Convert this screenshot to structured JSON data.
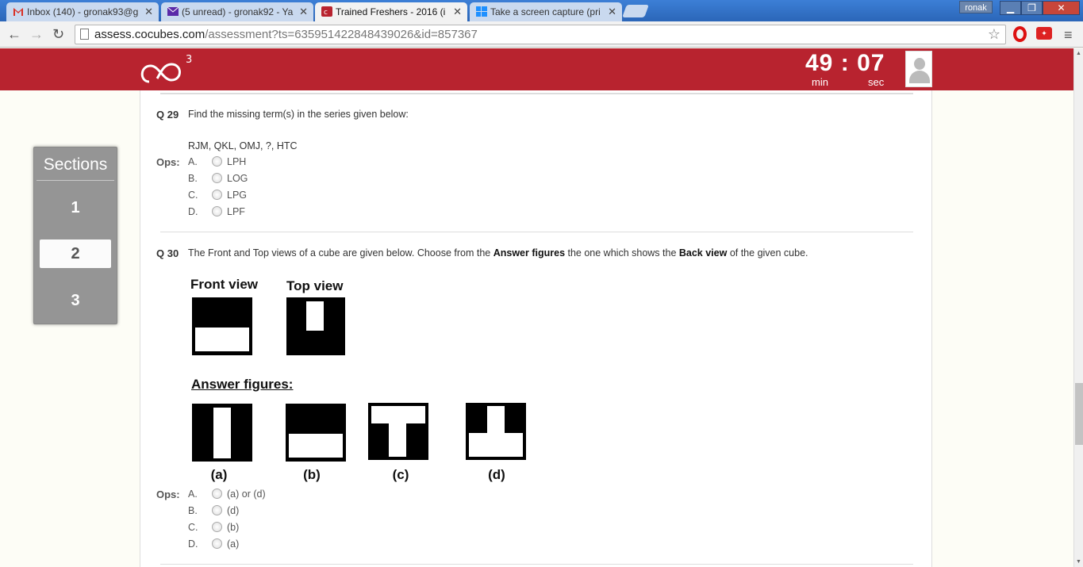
{
  "browser": {
    "tabs": [
      {
        "title": "Inbox (140) - gronak93@g"
      },
      {
        "title": "(5 unread) - gronak92 - Ya"
      },
      {
        "title": "Trained Freshers - 2016 (i"
      },
      {
        "title": "Take a screen capture (pri"
      }
    ],
    "user": "ronak",
    "url_host": "assess.cocubes.com",
    "url_path": "/assessment?ts=635951422848439026&id=857367"
  },
  "header": {
    "logo_superscript": "3",
    "timer": {
      "minutes": "49",
      "separator": ":",
      "seconds": "07",
      "min_label": "min",
      "sec_label": "sec"
    }
  },
  "sections": {
    "title": "Sections",
    "items": [
      "1",
      "2",
      "3"
    ],
    "active": "2"
  },
  "questions": [
    {
      "number": "Q 29",
      "text": "Find the missing term(s) in the series given below:",
      "series": "RJM, QKL, OMJ, ?, HTC",
      "ops_label": "Ops:",
      "options": [
        {
          "letter": "A.",
          "text": "LPH"
        },
        {
          "letter": "B.",
          "text": "LOG"
        },
        {
          "letter": "C.",
          "text": "LPG"
        },
        {
          "letter": "D.",
          "text": "LPF"
        }
      ]
    },
    {
      "number": "Q 30",
      "text_parts": [
        "The Front and Top views of a cube are given below. Choose from the ",
        "Answer figures",
        " the one which shows the ",
        "Back view",
        " of the given cube."
      ],
      "front_view_label": "Front view",
      "top_view_label": "Top view",
      "answer_figures_label": "Answer figures:",
      "figure_captions": [
        "(a)",
        "(b)",
        "(c)",
        "(d)"
      ],
      "ops_label": "Ops:",
      "options": [
        {
          "letter": "A.",
          "text": "(a) or (d)"
        },
        {
          "letter": "B.",
          "text": "(d)"
        },
        {
          "letter": "C.",
          "text": "(b)"
        },
        {
          "letter": "D.",
          "text": "(a)"
        }
      ]
    }
  ],
  "colors": {
    "brand_red": "#b8232f",
    "section_panel": "#959595"
  }
}
